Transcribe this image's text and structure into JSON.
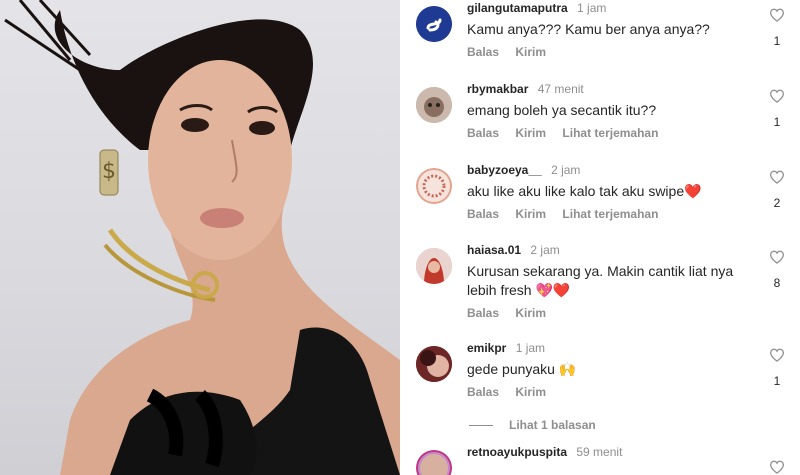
{
  "comments": [
    {
      "username": "gilangutamaputra",
      "time": "1 jam",
      "text": "Kamu anya??? Kamu ber anya anya??",
      "actions": [
        "Balas",
        "Kirim"
      ],
      "likes": "1",
      "avatar_color": "#1f3a93"
    },
    {
      "username": "rbymakbar",
      "time": "47 menit",
      "text": "emang boleh ya secantik itu??",
      "actions": [
        "Balas",
        "Kirim",
        "Lihat terjemahan"
      ],
      "likes": "1",
      "avatar_color": "#b7a398"
    },
    {
      "username": "babyzoeya__",
      "time": "2 jam",
      "text": "aku like aku like kalo tak aku swipe",
      "emoji": "❤️",
      "actions": [
        "Balas",
        "Kirim",
        "Lihat terjemahan"
      ],
      "likes": "2",
      "avatar_color": "#f2d8cf"
    },
    {
      "username": "haiasa.01",
      "time": "2 jam",
      "text": "Kurusan sekarang ya. Makin cantik liat nya lebih fresh",
      "emoji": "💖❤️",
      "actions": [
        "Balas",
        "Kirim"
      ],
      "likes": "8",
      "avatar_color": "#d9a6a0"
    },
    {
      "username": "emikpr",
      "time": "1 jam",
      "text": "gede punyaku",
      "emoji": "🙌",
      "actions": [
        "Balas",
        "Kirim"
      ],
      "likes": "1",
      "avatar_color": "#8b3a3a"
    },
    {
      "username": "retnoayukpuspita",
      "time": "59 menit",
      "text": "",
      "actions": [],
      "likes": "",
      "avatar_color": "#c48ac9"
    }
  ],
  "replies_link": "Lihat 1 balasan"
}
